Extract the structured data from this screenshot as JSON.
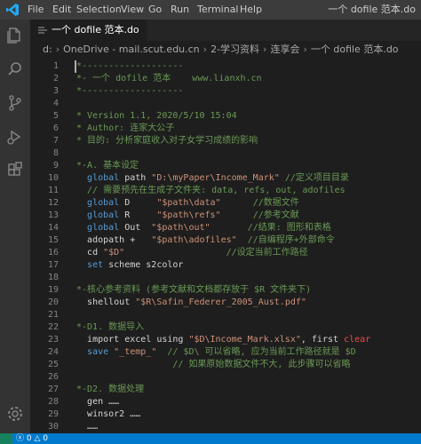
{
  "titlebar": {
    "menu": [
      "File",
      "Edit",
      "Selection",
      "View",
      "Go",
      "Run",
      "Terminal",
      "Help"
    ],
    "window_title": "一个 dofile 范本.do"
  },
  "tab": {
    "label": "一个 dofile 范本.do"
  },
  "breadcrumb": [
    "d:",
    "OneDrive - mail.scut.edu.cn",
    "2-学习资料",
    "连享会",
    "一个 dofile 范本.do"
  ],
  "editor": {
    "lines": [
      {
        "n": "1",
        "parts": [
          {
            "t": "*-------------------",
            "c": "cm"
          }
        ]
      },
      {
        "n": "2",
        "parts": [
          {
            "t": "*- 一个 dofile 范本    www.lianxh.cn",
            "c": "cm"
          }
        ]
      },
      {
        "n": "3",
        "parts": [
          {
            "t": "*-------------------",
            "c": "cm"
          }
        ]
      },
      {
        "n": "4",
        "parts": []
      },
      {
        "n": "5",
        "parts": [
          {
            "t": "* Version 1.1, 2020/5/10 15:04",
            "c": "cm"
          }
        ]
      },
      {
        "n": "6",
        "parts": [
          {
            "t": "* Author: 连家大公子",
            "c": "cm"
          }
        ]
      },
      {
        "n": "7",
        "parts": [
          {
            "t": "* 目的: 分析家庭收入对子女学习成绩的影响",
            "c": "cm"
          }
        ]
      },
      {
        "n": "8",
        "parts": []
      },
      {
        "n": "9",
        "parts": [
          {
            "t": "*-A. 基本设定",
            "c": "cm"
          }
        ]
      },
      {
        "n": "10",
        "parts": [
          {
            "t": "  "
          },
          {
            "t": "global",
            "c": "kw"
          },
          {
            "t": " path ",
            "c": "pl"
          },
          {
            "t": "\"D:\\myPaper\\Income_Mark\"",
            "c": "str"
          },
          {
            "t": " //定义项目目录",
            "c": "com"
          }
        ]
      },
      {
        "n": "11",
        "parts": [
          {
            "t": "  // 需要预先在生成子文件夹: data, refs, out, adofiles",
            "c": "com"
          }
        ]
      },
      {
        "n": "12",
        "parts": [
          {
            "t": "  "
          },
          {
            "t": "global",
            "c": "kw"
          },
          {
            "t": " D     ",
            "c": "pl"
          },
          {
            "t": "\"$path\\data\"",
            "c": "str"
          },
          {
            "t": "      //数据文件",
            "c": "com"
          }
        ]
      },
      {
        "n": "13",
        "parts": [
          {
            "t": "  "
          },
          {
            "t": "global",
            "c": "kw"
          },
          {
            "t": " R     ",
            "c": "pl"
          },
          {
            "t": "\"$path\\refs\"",
            "c": "str"
          },
          {
            "t": "      //参考文献",
            "c": "com"
          }
        ]
      },
      {
        "n": "14",
        "parts": [
          {
            "t": "  "
          },
          {
            "t": "global",
            "c": "kw"
          },
          {
            "t": " Out  ",
            "c": "pl"
          },
          {
            "t": "\"$path\\out\"",
            "c": "str"
          },
          {
            "t": "       //结果: 图形和表格",
            "c": "com"
          }
        ]
      },
      {
        "n": "15",
        "parts": [
          {
            "t": "  "
          },
          {
            "t": "adopath",
            "c": "pl"
          },
          {
            "t": " +   ",
            "c": "pl"
          },
          {
            "t": "\"$path\\adofiles\"",
            "c": "str"
          },
          {
            "t": "  //自编程序+外部命令",
            "c": "com"
          }
        ]
      },
      {
        "n": "16",
        "parts": [
          {
            "t": "  "
          },
          {
            "t": "cd",
            "c": "pl"
          },
          {
            "t": " ",
            "c": "pl"
          },
          {
            "t": "\"$D\"",
            "c": "str"
          },
          {
            "t": "                   //设定当前工作路径",
            "c": "com"
          }
        ]
      },
      {
        "n": "17",
        "parts": [
          {
            "t": "  "
          },
          {
            "t": "set",
            "c": "kw"
          },
          {
            "t": " scheme s2color",
            "c": "pl"
          }
        ]
      },
      {
        "n": "18",
        "parts": []
      },
      {
        "n": "19",
        "parts": [
          {
            "t": "*-核心参考资料 (参考文献和文档都存放于 $R 文件夹下)",
            "c": "cm"
          }
        ]
      },
      {
        "n": "20",
        "parts": [
          {
            "t": "  "
          },
          {
            "t": "shellout",
            "c": "pl"
          },
          {
            "t": " ",
            "c": "pl"
          },
          {
            "t": "\"$R\\Safin_Federer_2005_Aust.pdf\"",
            "c": "str"
          }
        ]
      },
      {
        "n": "21",
        "parts": []
      },
      {
        "n": "22",
        "parts": [
          {
            "t": "*-D1. 数据导入",
            "c": "cm"
          }
        ]
      },
      {
        "n": "23",
        "parts": [
          {
            "t": "  "
          },
          {
            "t": "import excel using ",
            "c": "pl"
          },
          {
            "t": "\"$D\\Income_Mark.xlsx\"",
            "c": "str"
          },
          {
            "t": ", first ",
            "c": "pl"
          },
          {
            "t": "clear",
            "c": "rd"
          }
        ]
      },
      {
        "n": "24",
        "parts": [
          {
            "t": "  "
          },
          {
            "t": "save",
            "c": "kw"
          },
          {
            "t": " ",
            "c": "pl"
          },
          {
            "t": "\"_temp_\"",
            "c": "str"
          },
          {
            "t": "  // $D\\ 可以省略, 应为当前工作路径就是 $D",
            "c": "com"
          }
        ]
      },
      {
        "n": "25",
        "parts": [
          {
            "t": "                  // 如果原始数据文件不大, 此步骤可以省略",
            "c": "com"
          }
        ]
      },
      {
        "n": "26",
        "parts": []
      },
      {
        "n": "27",
        "parts": [
          {
            "t": "*-D2. 数据处理",
            "c": "cm"
          }
        ]
      },
      {
        "n": "28",
        "parts": [
          {
            "t": "  "
          },
          {
            "t": "gen ……",
            "c": "pl"
          }
        ]
      },
      {
        "n": "29",
        "parts": [
          {
            "t": "  "
          },
          {
            "t": "winsor2 ……",
            "c": "pl"
          }
        ]
      },
      {
        "n": "30",
        "parts": [
          {
            "t": "  "
          },
          {
            "t": "……",
            "c": "pl"
          }
        ]
      }
    ]
  },
  "status": {
    "errors": "0",
    "warnings": "0"
  },
  "colors": {
    "statusbar": "#007acc",
    "comment": "#6a9955",
    "keyword": "#569cd6",
    "string": "#ce9178"
  }
}
